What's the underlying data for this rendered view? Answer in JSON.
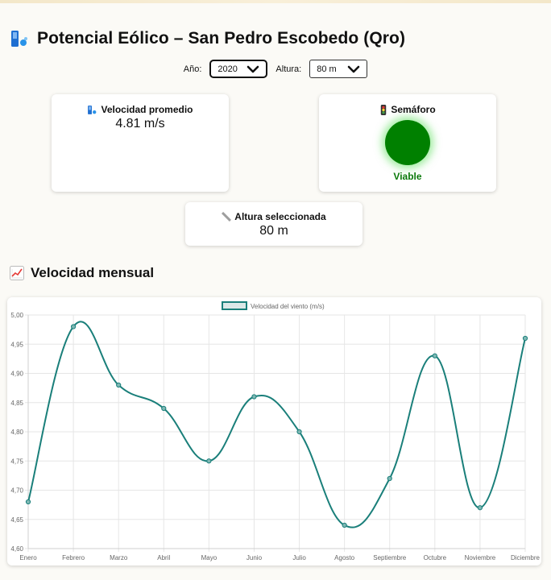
{
  "page": {
    "title": "Potencial Eólico – San Pedro Escobedo (Qro)",
    "title_icon": "wind-icon"
  },
  "controls": {
    "year_label": "Año:",
    "year_value": "2020",
    "height_label": "Altura:",
    "height_value": "80 m"
  },
  "cards": {
    "avg_speed": {
      "icon": "wind-icon",
      "title": "Velocidad promedio",
      "value": "4.81 m/s"
    },
    "semaforo": {
      "icon": "traffic-light-icon",
      "title": "Semáforo",
      "status": "Viable",
      "status_color": "#008000"
    },
    "height": {
      "icon": "ruler-icon",
      "title": "Altura seleccionada",
      "value": "80 m"
    }
  },
  "section": {
    "icon": "chart-increasing-icon",
    "title": "Velocidad mensual"
  },
  "chart_data": {
    "type": "line",
    "categories": [
      "Enero",
      "Febrero",
      "Marzo",
      "Abril",
      "Mayo",
      "Junio",
      "Julio",
      "Agosto",
      "Septiembre",
      "Octubre",
      "Noviembre",
      "Diciembre"
    ],
    "series": [
      {
        "name": "Velocidad del viento (m/s)",
        "values": [
          4.68,
          4.98,
          4.88,
          4.84,
          4.75,
          4.86,
          4.8,
          4.64,
          4.72,
          4.93,
          4.67,
          4.96
        ],
        "color": "#1a7f7a"
      }
    ],
    "ylim": [
      4.6,
      5.0
    ],
    "yticks": [
      "5,00",
      "4,95",
      "4,90",
      "4,85",
      "4,80",
      "4,75",
      "4,70",
      "4,65",
      "4,60"
    ],
    "grid": true,
    "legend": "top"
  }
}
